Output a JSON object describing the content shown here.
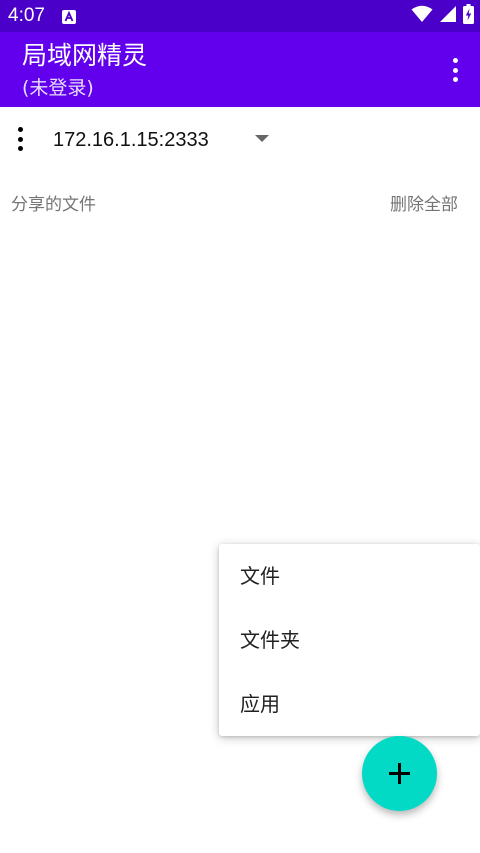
{
  "status_bar": {
    "time": "4:07",
    "notification_icon": "a-letter-icon",
    "icons": [
      "wifi-icon",
      "cellular-signal-icon",
      "battery-charging-icon"
    ],
    "background": "#4a00c8"
  },
  "app_bar": {
    "title": "局域网精灵",
    "subtitle": "(未登录)",
    "overflow_icon": "more-vert-icon",
    "background": "#6200ee"
  },
  "address": {
    "menu_icon": "more-vert-icon",
    "value": "172.16.1.15:2333",
    "dropdown_icon": "arrow-drop-down-icon"
  },
  "shared_files": {
    "label": "分享的文件",
    "delete_all_label": "删除全部",
    "items": []
  },
  "popup_menu": {
    "items": [
      {
        "label": "文件"
      },
      {
        "label": "文件夹"
      },
      {
        "label": "应用"
      }
    ]
  },
  "fab": {
    "icon": "plus-icon",
    "color": "#03dac5"
  }
}
